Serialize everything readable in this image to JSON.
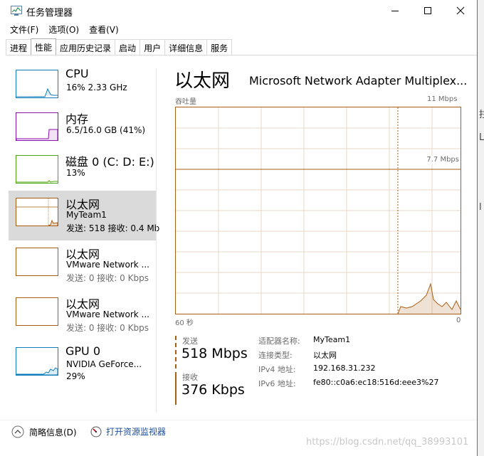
{
  "window": {
    "title": "任务管理器",
    "menu": [
      "文件(F)",
      "选项(O)",
      "查看(V)"
    ],
    "tabs": [
      "进程",
      "性能",
      "应用历史记录",
      "启动",
      "用户",
      "详细信息",
      "服务"
    ],
    "active_tab": "性能"
  },
  "sidebar": {
    "items": [
      {
        "title": "CPU",
        "line1": "16% 2.33 GHz",
        "line2": "",
        "color": "#117dbb"
      },
      {
        "title": "内存",
        "line1": "6.5/16.0 GB (41%)",
        "line2": "",
        "color": "#8b12ae"
      },
      {
        "title": "磁盘 0 (C: D: E:)",
        "line1": "13%",
        "line2": "",
        "color": "#4da60c"
      },
      {
        "title": "以太网",
        "line1": "MyTeam1",
        "line2": "发送: 518 接收: 0.4 Mb",
        "color": "#a75e10",
        "selected": true
      },
      {
        "title": "以太网",
        "line1": "VMware Network ...",
        "line2": "发送: 0 接收: 0 Kbps",
        "color": "#a75e10"
      },
      {
        "title": "以太网",
        "line1": "VMware Network ...",
        "line2": "发送: 0 接收: 0 Kbps",
        "color": "#a75e10"
      },
      {
        "title": "GPU 0",
        "line1": "NVIDIA GeForce...",
        "line2": "29%",
        "color": "#117dbb"
      }
    ]
  },
  "main": {
    "title": "以太网",
    "adapter": "Microsoft Network Adapter Multiplex...",
    "graph_label": "吞吐量",
    "max_scale": "11 Mbps",
    "mid_scale": "7.7 Mbps",
    "time_left": "60 秒",
    "time_right": "0",
    "send_label": "发送",
    "send_value": "518 Mbps",
    "recv_label": "接收",
    "recv_value": "376 Kbps",
    "details": [
      {
        "key": "适配器名称:",
        "value": "MyTeam1"
      },
      {
        "key": "连接类型:",
        "value": "以太网"
      },
      {
        "key": "IPv4 地址:",
        "value": "192.168.31.232"
      },
      {
        "key": "IPv6 地址:",
        "value": "fe80::c0a6:ec18:516d:eee3%27"
      }
    ]
  },
  "footer": {
    "fewer_details": "简略信息(D)",
    "open_monitor": "打开资源监视器"
  },
  "watermark": "https://blog.csdn.net/qq_38993101"
}
